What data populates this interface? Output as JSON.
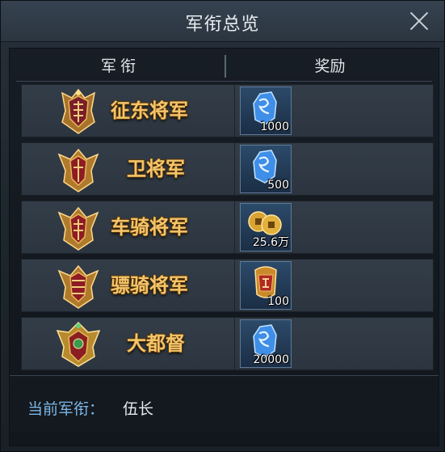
{
  "title": "军衔总览",
  "columns": {
    "rank": "军衔",
    "reward": "奖励"
  },
  "ranks": [
    {
      "name": "征东将军",
      "reward_icon": "blue-jade-icon",
      "reward_count": "1000"
    },
    {
      "name": "卫将军",
      "reward_icon": "blue-jade-icon",
      "reward_count": "500"
    },
    {
      "name": "车骑将军",
      "reward_icon": "copper-coins-icon",
      "reward_count": "25.6万"
    },
    {
      "name": "骠骑将军",
      "reward_icon": "golden-token-icon",
      "reward_count": "100"
    },
    {
      "name": "大都督",
      "reward_icon": "blue-jade-icon",
      "reward_count": "20000"
    }
  ],
  "current": {
    "label": "当前军衔：",
    "value": "伍长"
  },
  "colors": {
    "rank_text": "#f3c56c",
    "current_label": "#7fb7e6",
    "reward_frame": "#2c4a6a"
  }
}
